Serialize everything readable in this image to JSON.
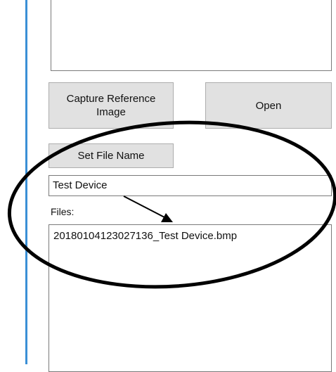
{
  "buttons": {
    "capture_line1": "Capture Reference",
    "capture_line2": "Image",
    "open": "Open",
    "set_file_name": "Set File Name"
  },
  "file_name_input": {
    "value": "Test Device"
  },
  "files": {
    "label": "Files:",
    "items": [
      "20180104123027136_Test Device.bmp"
    ]
  },
  "colors": {
    "window_border_accent": "#3a8fd6",
    "button_bg": "#e1e1e1",
    "annotation": "#000000"
  }
}
